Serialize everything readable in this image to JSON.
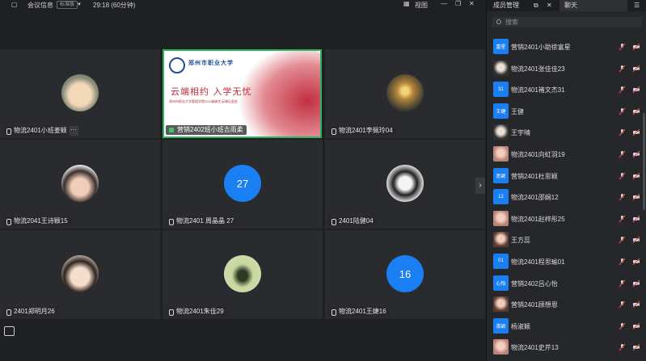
{
  "topbar": {
    "title": "会议信息",
    "badge": "标准版",
    "timer": "29:18 (60分钟)",
    "view_label": "视图"
  },
  "grid": {
    "tiles": [
      {
        "name": "物流2401小班姜颖",
        "avatar": "photo"
      },
      {
        "name": "营销2402班小班吉雨柔",
        "avatar": "slide"
      },
      {
        "name": "物流2401李佩玲04",
        "avatar": "photo"
      },
      {
        "name": "物流2041王诗颖15",
        "avatar": "photo"
      },
      {
        "name": "物流2401 周晶晶 27",
        "avatar": "number",
        "number": "27"
      },
      {
        "name": "2401陆健04",
        "avatar": "photo"
      },
      {
        "name": "2401郑明月26",
        "avatar": "photo"
      },
      {
        "name": "物流2401朱佳29",
        "avatar": "photo"
      },
      {
        "name": "物流2401王婕16",
        "avatar": "number",
        "number": "16"
      }
    ],
    "more_label": "···",
    "next_arrow": "›"
  },
  "slide": {
    "school": "郑州市职业大学",
    "headline": "云端相约  入学无忧",
    "subtitle": "郑州市职业大学管理学院2024级新生云端见面会"
  },
  "panel": {
    "tab_members": "成员管理",
    "tab_chat": "聊天",
    "search_placeholder": "搜索",
    "members": [
      {
        "avatar_text": "富星",
        "name": "营销2401小助徐富星"
      },
      {
        "avatar_text": "",
        "name": "物流2401张佳佳23"
      },
      {
        "avatar_text": "31",
        "name": "物流2401褚文杰31"
      },
      {
        "avatar_text": "王健",
        "name": "王健"
      },
      {
        "avatar_text": "",
        "name": "王宇晴"
      },
      {
        "avatar_text": "",
        "name": "物流2401向虹羽19"
      },
      {
        "avatar_text": "思颖",
        "name": "营销2401杜思颖"
      },
      {
        "avatar_text": "12",
        "name": "物流2401邵娴12"
      },
      {
        "avatar_text": "",
        "name": "物流2401赵梓彤25"
      },
      {
        "avatar_text": "",
        "name": "王方蕊"
      },
      {
        "avatar_text": "01",
        "name": "物流2401程思瑜01"
      },
      {
        "avatar_text": "心怡",
        "name": "营销2402吕心怡"
      },
      {
        "avatar_text": "",
        "name": "营销2401顾想恩"
      },
      {
        "avatar_text": "淑颖",
        "name": "杨淑颖"
      },
      {
        "avatar_text": "",
        "name": "物流2401史芹13"
      }
    ]
  },
  "colors": {
    "accent_blue": "#1a7ff3",
    "active_speaker_green": "#2bb35d",
    "mic_off_red": "#e24b4b"
  }
}
